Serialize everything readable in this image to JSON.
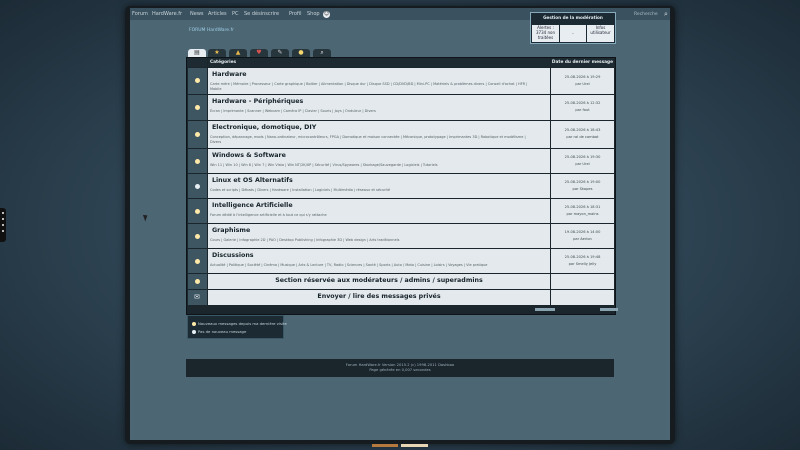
{
  "nav": [
    "Forum",
    "HardWare.fr",
    "News",
    "Articles",
    "PC",
    "Se désinscrire",
    "Profil",
    "Shop"
  ],
  "nav_right": "Recherche",
  "moderation": {
    "title": "Gestion de la modération",
    "alerts": "Alertes : 3734 non traitées",
    "middle": "-",
    "info": "Infos utilisateur"
  },
  "breadcrumb": "FORUM HardWare.fr",
  "tabs": [
    "page",
    "star",
    "cat",
    "heart",
    "wrench",
    "pin",
    "search"
  ],
  "headers": {
    "categories": "Catégories",
    "last": "Date du dernier message"
  },
  "forums": [
    {
      "title": "Hardware",
      "sub": [
        "Carte mère | Mémoire | Processeur | Carte graphique | Boitier | Alimentation | Disque dur | Disque SSD | CD/DVD/BD | Mini-PC | Matériels & problèmes divers | Conseil d'achat | HFR |",
        "Mobile"
      ],
      "date": "25-08-2026 à 19:29",
      "by": "par Urei",
      "bulb": "#ffe9a8"
    },
    {
      "title": "Hardware - Périphériques",
      "sub": [
        "Écran | Imprimante | Scanner | Webcam | Caméra IP | Clavier | Souris | Joys | Onduleur | Divers"
      ],
      "date": "25-08-2026 à 12:32",
      "by": "par fout",
      "bulb": "#ffe9a8"
    },
    {
      "title": "Electronique, domotique, DIY",
      "sub": [
        "Conception, dépannage, mods | Nano-ordinateur, microcontrôleurs, FPGA | Domotique et maison connectée | Mécanique, prototypage | Imprimantes 3D | Robotique et modélisme |",
        "Divers"
      ],
      "date": "25-08-2026 à 18:43",
      "by": "par ral de combat",
      "bulb": "#ffe9a8"
    },
    {
      "title": "Windows & Software",
      "sub": [
        "Win 11 | Win 10 | Win 8 | Win 7 | Win Vista | Win NT/2K/XP | Sécurité | Virus/Spywares | Stockage/Sauvegarde | Logiciels | Tutoriels"
      ],
      "date": "25-08-2026 à 19:30",
      "by": "par Urei",
      "bulb": "#ffe9a8"
    },
    {
      "title": "Linux et OS Alternatifs",
      "sub": [
        "Codes et scripts | Débats | Divers | Hardware | Installation | Logiciels | Multimédia | réseaux et sécurité"
      ],
      "date": "25-08-2026 à 19:00",
      "by": "par Skopes",
      "bulb": "#e4eef3"
    },
    {
      "title": "Intelligence Artificielle",
      "sub": [
        "Forum dédié à l'intelligence artificielle et à tout ce qui s'y rattache"
      ],
      "date": "25-08-2026 à 18:31",
      "by": "par mayon_mains",
      "bulb": "#ffe9a8"
    },
    {
      "title": "Graphisme",
      "sub": [
        "Cours | Galerie | Infographie 2D | PAO | Desktop Publishing | Infographie 3D | Web design | Arts traditionnels"
      ],
      "date": "19-08-2026 à 14:00",
      "by": "par Aerion",
      "bulb": "#ffe9a8"
    },
    {
      "title": "Discussions",
      "sub": [
        "Actualité | Politique | Société | Cinéma | Musique | Arts & Lecture | TV, Radio | Sciences | Santé | Sports | Auto / Moto | Cuisine | Loisirs | Voyages | Vie pratique"
      ],
      "date": "25-08-2026 à 19:48",
      "by": "par Smelly Jelly",
      "bulb": "#ffe9a8"
    }
  ],
  "special_rows": [
    {
      "title": "Section réservée aux modérateurs / admins / superadmins"
    },
    {
      "title": "Envoyer / lire des messages privés"
    }
  ],
  "stats": [
    "Nombre total de messages :",
    "Membres Enregistrés :"
  ],
  "legend": [
    "Nouveaux messages depuis ma dernière visite",
    "Pas de nouveau message"
  ],
  "footer": [
    "Forum HardWare.fr    Version 2015.2 (c) 1998-2011 Dashboo",
    "Page générée en 0,007 secondes"
  ]
}
